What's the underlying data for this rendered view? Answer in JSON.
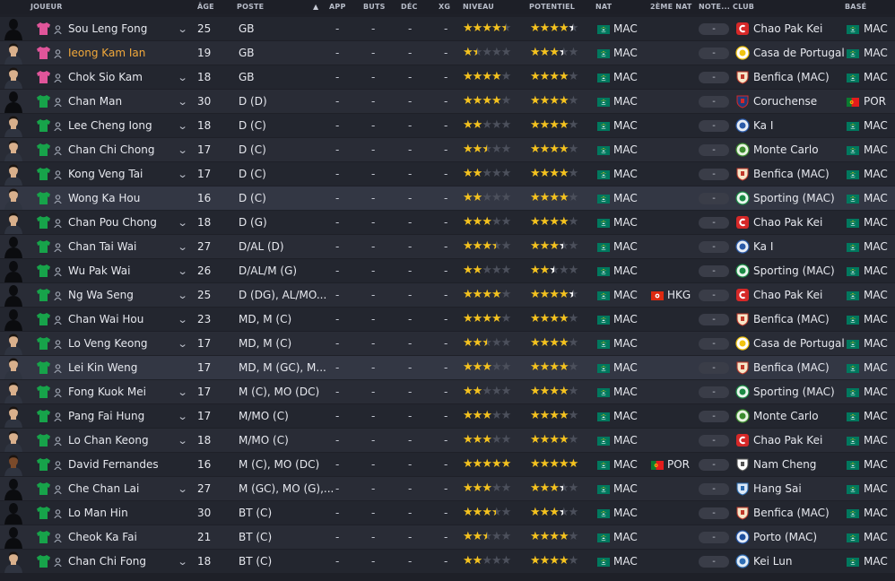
{
  "columns": {
    "joueur": "JOUEUR",
    "age": "ÂGE",
    "poste": "POSTE",
    "app": "APP",
    "buts": "BUTS",
    "dec": "DÉC",
    "xg": "XG",
    "niveau": "NIVEAU",
    "potentiel": "POTENTIEL",
    "nat": "NAT",
    "nat2": "2ÈME NAT",
    "note": "NOTE...",
    "club": "CLUB",
    "base": "BASÉ"
  },
  "sort_icon": "sort-ascending-arrow-icon",
  "colors": {
    "gk_shirt": "#e0559a",
    "outfield_shirt": "#17a34a",
    "star_gold": "#f4c21f",
    "star_white": "#ffffff",
    "highlight_name": "#f2a93b"
  },
  "players": [
    {
      "name": "Sou Leng Fong",
      "age": "25",
      "pos": "GB",
      "app": "-",
      "buts": "-",
      "dec": "-",
      "xg": "-",
      "niveau": 4.5,
      "potentiel": 4.5,
      "nat": "MAC",
      "nat2": "",
      "note": "-",
      "club": "Chao Pak Kei",
      "club_icon": "chao-pak-kei-crest",
      "base": "MAC",
      "gk": true,
      "chevron": true,
      "highlight": false,
      "avatar": "silhouette"
    },
    {
      "name": "Ieong Kam Ian",
      "age": "19",
      "pos": "GB",
      "app": "-",
      "buts": "-",
      "dec": "-",
      "xg": "-",
      "niveau": 1.5,
      "potentiel": 3.5,
      "nat": "MAC",
      "nat2": "",
      "note": "-",
      "club": "Casa de Portugal",
      "club_icon": "casa-de-portugal-crest",
      "base": "MAC",
      "gk": true,
      "chevron": false,
      "highlight": true,
      "avatar": "photo"
    },
    {
      "name": "Chok Sio Kam",
      "age": "18",
      "pos": "GB",
      "app": "-",
      "buts": "-",
      "dec": "-",
      "xg": "-",
      "niveau": 4,
      "potentiel": 4,
      "nat": "MAC",
      "nat2": "",
      "note": "-",
      "club": "Benfica (MAC)",
      "club_icon": "benfica-crest",
      "base": "MAC",
      "gk": true,
      "chevron": true,
      "highlight": false,
      "avatar": "photo"
    },
    {
      "name": "Chan Man",
      "age": "30",
      "pos": "D (D)",
      "app": "-",
      "buts": "-",
      "dec": "-",
      "xg": "-",
      "niveau": 4,
      "potentiel": 4,
      "nat": "MAC",
      "nat2": "",
      "note": "-",
      "club": "Coruchense",
      "club_icon": "coruchense-crest",
      "base": "POR",
      "gk": false,
      "chevron": true,
      "highlight": false,
      "avatar": "silhouette"
    },
    {
      "name": "Lee Cheng Iong",
      "age": "18",
      "pos": "D (C)",
      "app": "-",
      "buts": "-",
      "dec": "-",
      "xg": "-",
      "niveau": 2,
      "potentiel": 4,
      "nat": "MAC",
      "nat2": "",
      "note": "-",
      "club": "Ka I",
      "club_icon": "ka-i-crest",
      "base": "MAC",
      "gk": false,
      "chevron": true,
      "highlight": false,
      "avatar": "photo"
    },
    {
      "name": "Chan Chi Chong",
      "age": "17",
      "pos": "D (C)",
      "app": "-",
      "buts": "-",
      "dec": "-",
      "xg": "-",
      "niveau": 2.5,
      "potentiel": 4,
      "nat": "MAC",
      "nat2": "",
      "note": "-",
      "club": "Monte Carlo",
      "club_icon": "monte-carlo-crest",
      "base": "MAC",
      "gk": false,
      "chevron": true,
      "highlight": false,
      "avatar": "photo"
    },
    {
      "name": "Kong Veng Tai",
      "age": "17",
      "pos": "D (C)",
      "app": "-",
      "buts": "-",
      "dec": "-",
      "xg": "-",
      "niveau": 2,
      "potentiel": 4,
      "nat": "MAC",
      "nat2": "",
      "note": "-",
      "club": "Benfica (MAC)",
      "club_icon": "benfica-crest",
      "base": "MAC",
      "gk": false,
      "chevron": true,
      "highlight": false,
      "avatar": "photo"
    },
    {
      "name": "Wong Ka Hou",
      "age": "16",
      "pos": "D (C)",
      "app": "-",
      "buts": "-",
      "dec": "-",
      "xg": "-",
      "niveau": 2,
      "potentiel": 4,
      "nat": "MAC",
      "nat2": "",
      "note": "-",
      "club": "Sporting (MAC)",
      "club_icon": "sporting-crest",
      "base": "MAC",
      "gk": false,
      "chevron": false,
      "highlight": false,
      "avatar": "photo"
    },
    {
      "name": "Chan Pou Chong",
      "age": "18",
      "pos": "D (G)",
      "app": "-",
      "buts": "-",
      "dec": "-",
      "xg": "-",
      "niveau": 3,
      "potentiel": 4,
      "nat": "MAC",
      "nat2": "",
      "note": "-",
      "club": "Chao Pak Kei",
      "club_icon": "chao-pak-kei-crest",
      "base": "MAC",
      "gk": false,
      "chevron": true,
      "highlight": false,
      "avatar": "photo"
    },
    {
      "name": "Chan Tai Wai",
      "age": "27",
      "pos": "D/AL (D)",
      "app": "-",
      "buts": "-",
      "dec": "-",
      "xg": "-",
      "niveau": 3.5,
      "potentiel": 3.5,
      "nat": "MAC",
      "nat2": "",
      "note": "-",
      "club": "Ka I",
      "club_icon": "ka-i-crest",
      "base": "MAC",
      "gk": false,
      "chevron": true,
      "highlight": false,
      "avatar": "silhouette"
    },
    {
      "name": "Wu Pak Wai",
      "age": "26",
      "pos": "D/AL/M (G)",
      "app": "-",
      "buts": "-",
      "dec": "-",
      "xg": "-",
      "niveau": 2,
      "potentiel": 2.5,
      "nat": "MAC",
      "nat2": "",
      "note": "-",
      "club": "Sporting (MAC)",
      "club_icon": "sporting-crest",
      "base": "MAC",
      "gk": false,
      "chevron": true,
      "highlight": false,
      "avatar": "silhouette"
    },
    {
      "name": "Ng Wa Seng",
      "age": "25",
      "pos": "D (DG), AL/MO...",
      "app": "-",
      "buts": "-",
      "dec": "-",
      "xg": "-",
      "niveau": 4,
      "potentiel": 4.5,
      "nat": "MAC",
      "nat2": "HKG",
      "nat2_flag": "hong-kong-flag",
      "note": "-",
      "club": "Chao Pak Kei",
      "club_icon": "chao-pak-kei-crest",
      "base": "MAC",
      "gk": false,
      "chevron": true,
      "highlight": false,
      "avatar": "silhouette"
    },
    {
      "name": "Chan Wai Hou",
      "age": "23",
      "pos": "MD, M (C)",
      "app": "-",
      "buts": "-",
      "dec": "-",
      "xg": "-",
      "niveau": 4,
      "potentiel": 4,
      "nat": "MAC",
      "nat2": "",
      "note": "-",
      "club": "Benfica (MAC)",
      "club_icon": "benfica-crest",
      "base": "MAC",
      "gk": false,
      "chevron": true,
      "highlight": false,
      "avatar": "silhouette"
    },
    {
      "name": "Lo Veng Keong",
      "age": "17",
      "pos": "MD, M (C)",
      "app": "-",
      "buts": "-",
      "dec": "-",
      "xg": "-",
      "niveau": 2.5,
      "potentiel": 4,
      "nat": "MAC",
      "nat2": "",
      "note": "-",
      "club": "Casa de Portugal",
      "club_icon": "casa-de-portugal-crest",
      "base": "MAC",
      "gk": false,
      "chevron": true,
      "highlight": false,
      "avatar": "photo"
    },
    {
      "name": "Lei Kin Weng",
      "age": "17",
      "pos": "MD, M (GC), M...",
      "app": "-",
      "buts": "-",
      "dec": "-",
      "xg": "-",
      "niveau": 3,
      "potentiel": 4,
      "nat": "MAC",
      "nat2": "",
      "note": "-",
      "club": "Benfica (MAC)",
      "club_icon": "benfica-crest",
      "base": "MAC",
      "gk": false,
      "chevron": false,
      "highlight": false,
      "avatar": "photo"
    },
    {
      "name": "Fong Kuok Mei",
      "age": "17",
      "pos": "M (C), MO (DC)",
      "app": "-",
      "buts": "-",
      "dec": "-",
      "xg": "-",
      "niveau": 2,
      "potentiel": 4,
      "nat": "MAC",
      "nat2": "",
      "note": "-",
      "club": "Sporting (MAC)",
      "club_icon": "sporting-crest",
      "base": "MAC",
      "gk": false,
      "chevron": true,
      "highlight": false,
      "avatar": "photo"
    },
    {
      "name": "Pang Fai Hung",
      "age": "17",
      "pos": "M/MO (C)",
      "app": "-",
      "buts": "-",
      "dec": "-",
      "xg": "-",
      "niveau": 3,
      "potentiel": 4,
      "nat": "MAC",
      "nat2": "",
      "note": "-",
      "club": "Monte Carlo",
      "club_icon": "monte-carlo-crest",
      "base": "MAC",
      "gk": false,
      "chevron": true,
      "highlight": false,
      "avatar": "photo"
    },
    {
      "name": "Lo Chan Keong",
      "age": "18",
      "pos": "M/MO (C)",
      "app": "-",
      "buts": "-",
      "dec": "-",
      "xg": "-",
      "niveau": 3,
      "potentiel": 4,
      "nat": "MAC",
      "nat2": "",
      "note": "-",
      "club": "Chao Pak Kei",
      "club_icon": "chao-pak-kei-crest",
      "base": "MAC",
      "gk": false,
      "chevron": true,
      "highlight": false,
      "avatar": "photo"
    },
    {
      "name": "David Fernandes",
      "age": "16",
      "pos": "M (C), MO (DC)",
      "app": "-",
      "buts": "-",
      "dec": "-",
      "xg": "-",
      "niveau": 5,
      "potentiel": 5,
      "nat": "MAC",
      "nat2": "POR",
      "nat2_flag": "portugal-flag",
      "note": "-",
      "club": "Nam Cheng",
      "club_icon": "nam-cheng-crest",
      "base": "MAC",
      "gk": false,
      "chevron": false,
      "highlight": false,
      "avatar": "photo-dark"
    },
    {
      "name": "Che Chan Lai",
      "age": "27",
      "pos": "M (GC), MO (G),...",
      "app": "-",
      "buts": "-",
      "dec": "-",
      "xg": "-",
      "niveau": 3,
      "potentiel": 3.5,
      "nat": "MAC",
      "nat2": "",
      "note": "-",
      "club": "Hang Sai",
      "club_icon": "hang-sai-crest",
      "base": "MAC",
      "gk": false,
      "chevron": true,
      "highlight": false,
      "avatar": "silhouette"
    },
    {
      "name": "Lo Man Hin",
      "age": "30",
      "pos": "BT (C)",
      "app": "-",
      "buts": "-",
      "dec": "-",
      "xg": "-",
      "niveau": 3.5,
      "potentiel": 3.5,
      "nat": "MAC",
      "nat2": "",
      "note": "-",
      "club": "Benfica (MAC)",
      "club_icon": "benfica-crest",
      "base": "MAC",
      "gk": false,
      "chevron": false,
      "highlight": false,
      "avatar": "silhouette"
    },
    {
      "name": "Cheok Ka Fai",
      "age": "21",
      "pos": "BT (C)",
      "app": "-",
      "buts": "-",
      "dec": "-",
      "xg": "-",
      "niveau": 2.5,
      "potentiel": 4,
      "nat": "MAC",
      "nat2": "",
      "note": "-",
      "club": "Porto (MAC)",
      "club_icon": "porto-crest",
      "base": "MAC",
      "gk": false,
      "chevron": false,
      "highlight": false,
      "avatar": "silhouette"
    },
    {
      "name": "Chan Chi Fong",
      "age": "18",
      "pos": "BT (C)",
      "app": "-",
      "buts": "-",
      "dec": "-",
      "xg": "-",
      "niveau": 2,
      "potentiel": 4,
      "nat": "MAC",
      "nat2": "",
      "note": "-",
      "club": "Kei Lun",
      "club_icon": "kei-lun-crest",
      "base": "MAC",
      "gk": false,
      "chevron": true,
      "highlight": false,
      "avatar": "photo"
    }
  ]
}
